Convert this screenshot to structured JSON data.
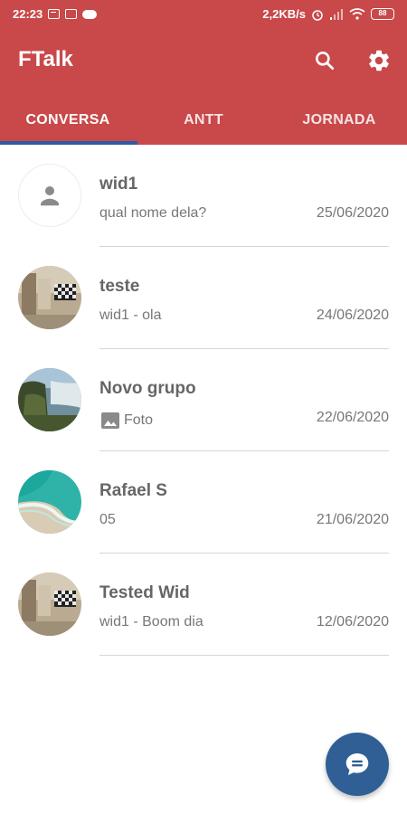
{
  "status_bar": {
    "time": "22:23",
    "network_speed": "2,2KB/s",
    "battery": "88",
    "icons": [
      "gmail-icon",
      "calendar-icon",
      "cloud-icon",
      "alarm-icon",
      "signal-icon",
      "wifi-icon",
      "battery-icon"
    ]
  },
  "app_bar": {
    "title": "FTalk",
    "background_color": "#c9484a",
    "actions": [
      "search-icon",
      "settings-icon"
    ]
  },
  "tabs": [
    {
      "label": "CONVERSA",
      "active": true
    },
    {
      "label": "ANTT",
      "active": false
    },
    {
      "label": "JORNADA",
      "active": false
    }
  ],
  "tab_indicator_color": "#2f5aa8",
  "chats": [
    {
      "name": "wid1",
      "preview": "qual nome dela?",
      "date": "25/06/2020",
      "avatar": "default-person"
    },
    {
      "name": "teste",
      "preview": "wid1 - ola",
      "date": "24/06/2020",
      "avatar": "room-photo"
    },
    {
      "name": "Novo grupo",
      "preview": "Foto",
      "preview_icon": "image-icon",
      "date": "22/06/2020",
      "avatar": "waterfall-photo"
    },
    {
      "name": "Rafael S",
      "preview": "05",
      "date": "21/06/2020",
      "avatar": "ocean-photo"
    },
    {
      "name": "Tested Wid",
      "preview": "wid1 - Boom dia",
      "date": "12/06/2020",
      "avatar": "room-photo"
    }
  ],
  "fab": {
    "icon": "chat-bubble-icon",
    "color": "#2f5f94"
  }
}
